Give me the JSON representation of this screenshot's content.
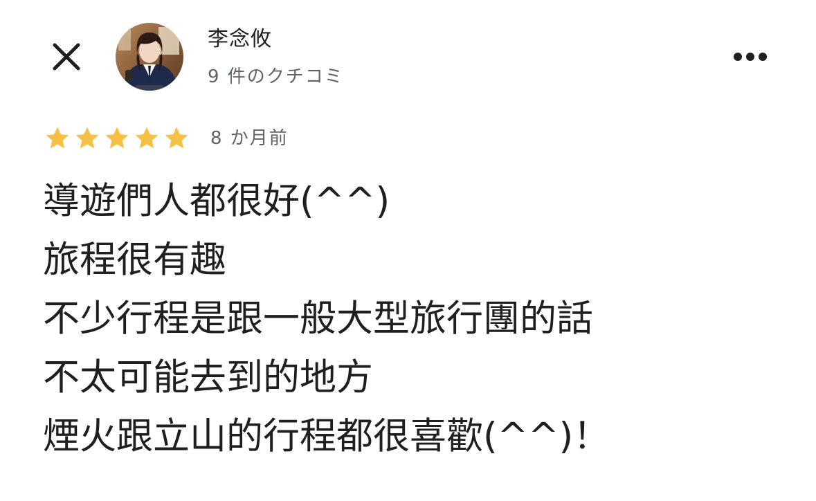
{
  "reviewer": {
    "name": "李念攸",
    "review_count": "9 件のクチコミ"
  },
  "review": {
    "rating": 5,
    "rating_max": 5,
    "date": "8 か月前",
    "lines": [
      "導遊們人都很好(^^)",
      "旅程很有趣",
      "不少行程是跟一般大型旅行團的話",
      "不太可能去到的地方",
      "煙火跟立山的行程都很喜歡(^^)！"
    ]
  },
  "icons": {
    "close": "close-icon",
    "more": "more-horizontal-icon",
    "star": "star-icon"
  },
  "colors": {
    "star": "#F6C044",
    "text_primary": "#1f1f1f",
    "text_secondary": "#5f6368",
    "background": "#ffffff"
  }
}
